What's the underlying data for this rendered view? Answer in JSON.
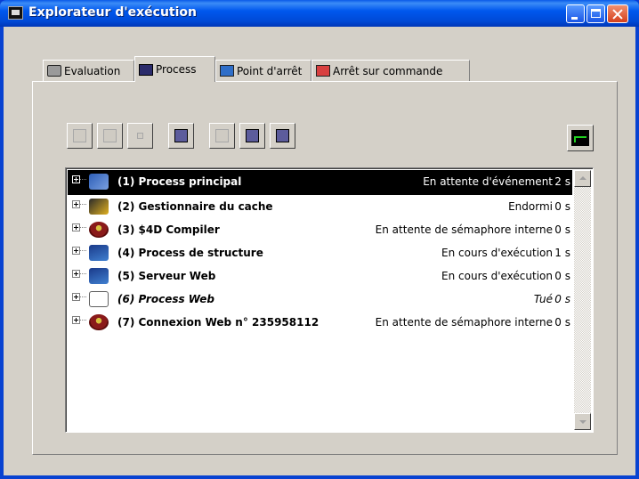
{
  "window": {
    "title": "Explorateur d'exécution"
  },
  "tabs": [
    {
      "label": "Evaluation",
      "icon": "evaluation-icon",
      "active": false
    },
    {
      "label": "Process",
      "icon": "process-icon",
      "active": true
    },
    {
      "label": "Point d'arrêt",
      "icon": "breakpoint-icon",
      "active": false
    },
    {
      "label": "Arrêt sur commande",
      "icon": "stop-on-command-icon",
      "active": false
    }
  ],
  "toolbar": {
    "buttons": [
      {
        "name": "abort-process",
        "enabled": false
      },
      {
        "name": "pause-process",
        "enabled": false
      },
      {
        "name": "stop-process",
        "enabled": false
      },
      {
        "name": "trace-process",
        "enabled": true
      },
      {
        "name": "show-process",
        "enabled": false
      },
      {
        "name": "hide-process",
        "enabled": true
      },
      {
        "name": "activate-process",
        "enabled": true
      }
    ],
    "monitor_button": "monitor-icon"
  },
  "processes": [
    {
      "name": "(1) Process principal",
      "state": "En attente d'événement",
      "time": "2 s",
      "icon": "principal-process-icon",
      "selected": true,
      "italic": false
    },
    {
      "name": "(2) Gestionnaire du cache",
      "state": "Endormi",
      "time": "0 s",
      "icon": "cache-manager-icon",
      "selected": false,
      "italic": false
    },
    {
      "name": "(3) $4D Compiler",
      "state": "En attente de sémaphore interne",
      "time": "0 s",
      "icon": "compiler-icon",
      "selected": false,
      "italic": false
    },
    {
      "name": "(4) Process de structure",
      "state": "En cours d'exécution",
      "time": "1 s",
      "icon": "structure-process-icon",
      "selected": false,
      "italic": false
    },
    {
      "name": "(5) Serveur Web",
      "state": "En cours d'exécution",
      "time": "0 s",
      "icon": "web-server-icon",
      "selected": false,
      "italic": false
    },
    {
      "name": "(6) Process Web",
      "state": "Tué",
      "time": "0 s",
      "icon": "web-process-icon",
      "selected": false,
      "italic": true
    },
    {
      "name": "(7) Connexion Web n° 235958112",
      "state": "En attente de sémaphore interne",
      "time": "0 s",
      "icon": "web-connection-icon",
      "selected": false,
      "italic": false
    }
  ],
  "colors": {
    "titlebar": "#0058ee",
    "selection": "#000000",
    "face": "#d4d0c8"
  }
}
